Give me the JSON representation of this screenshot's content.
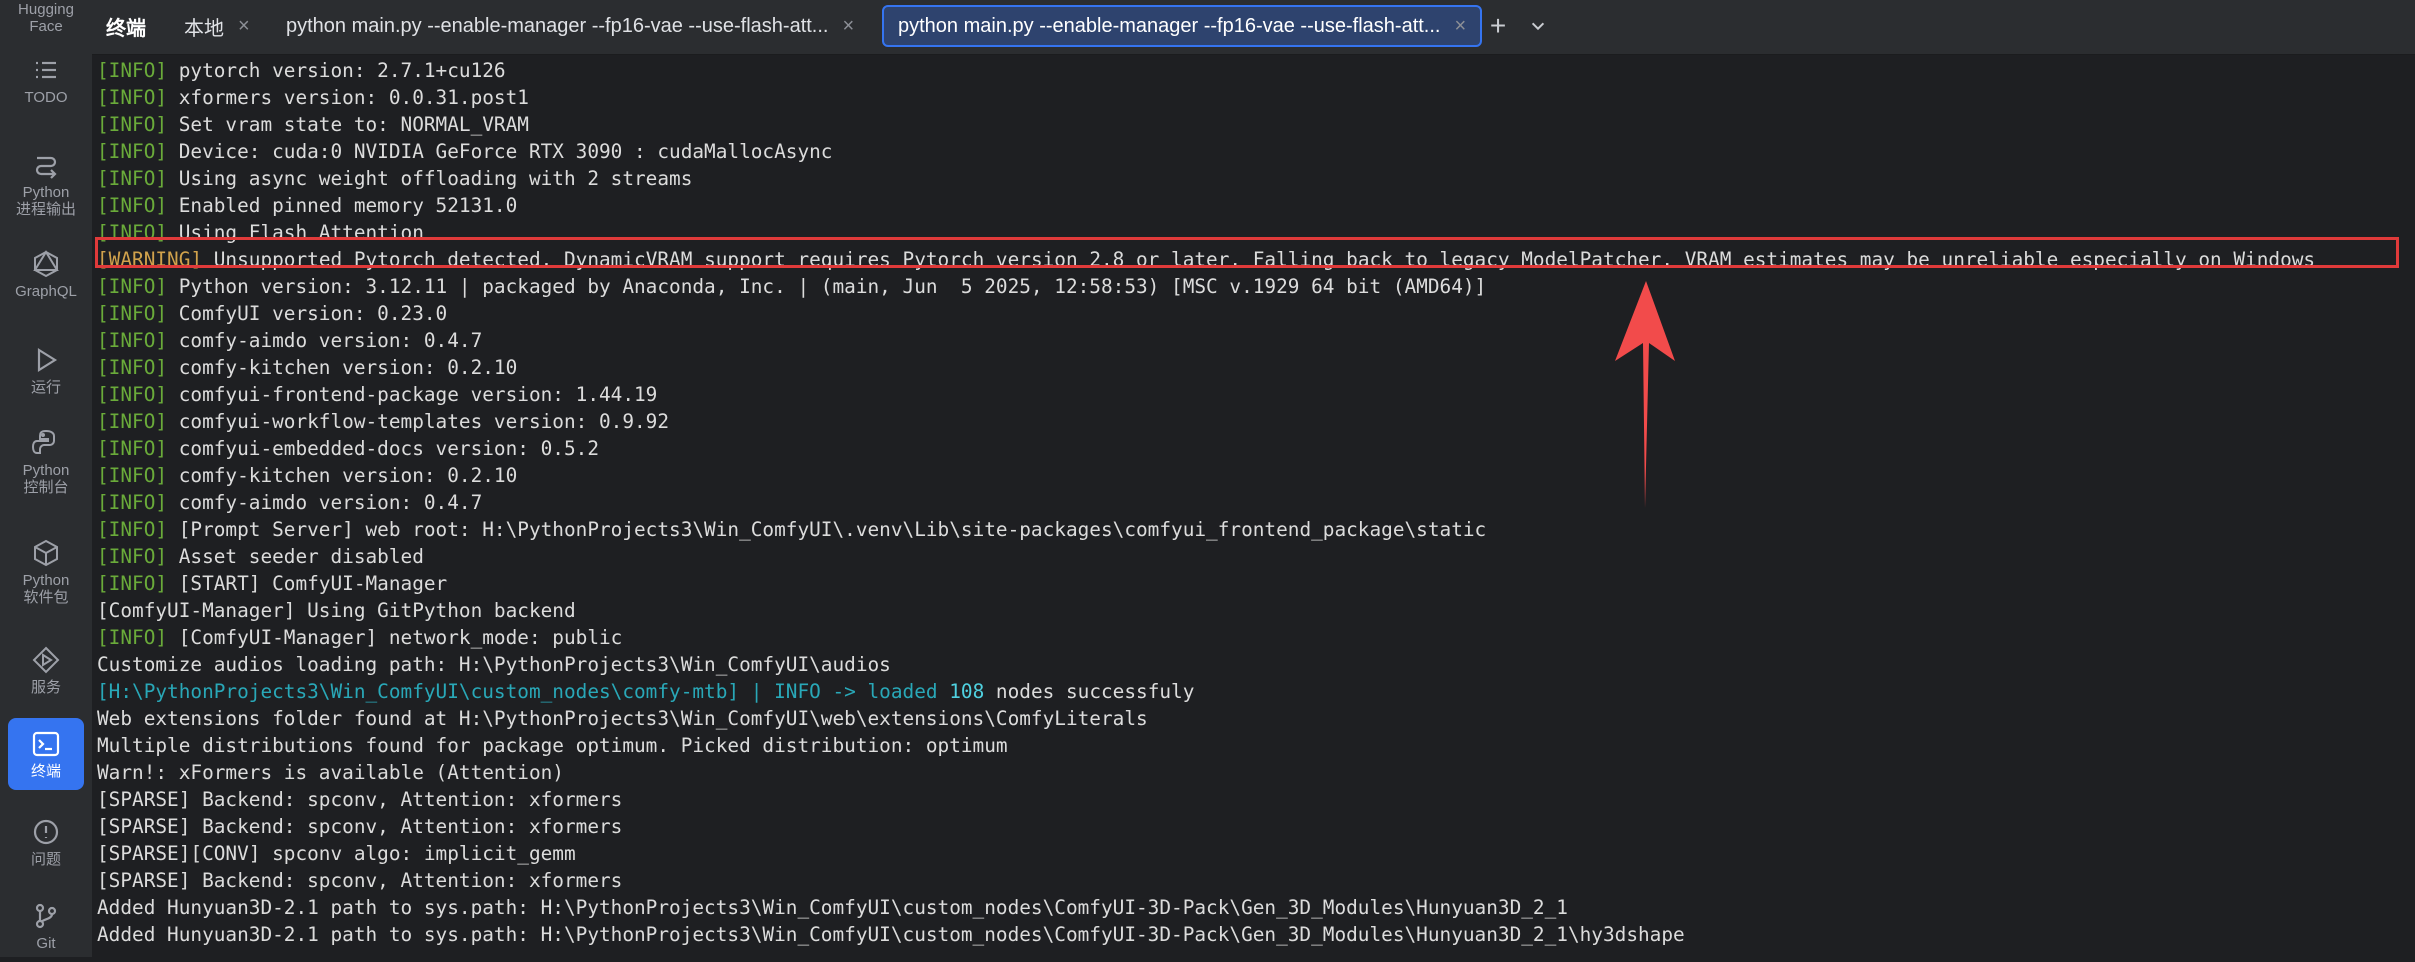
{
  "sidebar": {
    "items": [
      {
        "label": "Hugging\nFace",
        "icon": "hugging-face-icon"
      },
      {
        "label": "TODO",
        "icon": "todo-list-icon"
      },
      {
        "label": "Python\n进程输出",
        "icon": "process-output-icon"
      },
      {
        "label": "GraphQL",
        "icon": "graphql-icon"
      },
      {
        "label": "运行",
        "icon": "run-icon"
      },
      {
        "label": "Python\n控制台",
        "icon": "python-console-icon"
      },
      {
        "label": "Python\n软件包",
        "icon": "python-packages-icon"
      },
      {
        "label": "服务",
        "icon": "services-icon"
      },
      {
        "label": "终端",
        "icon": "terminal-icon",
        "active": true
      },
      {
        "label": "问题",
        "icon": "problems-icon"
      },
      {
        "label": "Git",
        "icon": "git-icon"
      }
    ]
  },
  "tabs": {
    "title": "终端",
    "items": [
      {
        "label": "本地"
      },
      {
        "label": "python main.py --enable-manager --fp16-vae --use-flash-att..."
      },
      {
        "label": "python main.py --enable-manager --fp16-vae --use-flash-att...",
        "active": true
      }
    ]
  },
  "terminal": {
    "lines": [
      {
        "level": "[INFO]",
        "text": " pytorch version: 2.7.1+cu126"
      },
      {
        "level": "[INFO]",
        "text": " xformers version: 0.0.31.post1"
      },
      {
        "level": "[INFO]",
        "text": " Set vram state to: NORMAL_VRAM"
      },
      {
        "level": "[INFO]",
        "text": " Device: cuda:0 NVIDIA GeForce RTX 3090 : cudaMallocAsync"
      },
      {
        "level": "[INFO]",
        "text": " Using async weight offloading with 2 streams"
      },
      {
        "level": "[INFO]",
        "text": " Enabled pinned memory 52131.0"
      },
      {
        "level": "[INFO]",
        "text": " Using Flash Attention"
      },
      {
        "level": "[WARNING]",
        "warn": true,
        "text": " Unsupported Pytorch detected. DynamicVRAM support requires Pytorch version 2.8 or later. Falling back to legacy ModelPatcher. VRAM estimates may be unreliable especially on Windows"
      },
      {
        "level": "[INFO]",
        "text": " Python version: 3.12.11 | packaged by Anaconda, Inc. | (main, Jun  5 2025, 12:58:53) [MSC v.1929 64 bit (AMD64)]"
      },
      {
        "level": "[INFO]",
        "text": " ComfyUI version: 0.23.0"
      },
      {
        "level": "[INFO]",
        "text": " comfy-aimdo version: 0.4.7"
      },
      {
        "level": "[INFO]",
        "text": " comfy-kitchen version: 0.2.10"
      },
      {
        "level": "[INFO]",
        "text": " comfyui-frontend-package version: 1.44.19"
      },
      {
        "level": "[INFO]",
        "text": " comfyui-workflow-templates version: 0.9.92"
      },
      {
        "level": "[INFO]",
        "text": " comfyui-embedded-docs version: 0.5.2"
      },
      {
        "level": "[INFO]",
        "text": " comfy-kitchen version: 0.2.10"
      },
      {
        "level": "[INFO]",
        "text": " comfy-aimdo version: 0.4.7"
      },
      {
        "level": "[INFO]",
        "text": " [Prompt Server] web root: H:\\PythonProjects3\\Win_ComfyUI\\.venv\\Lib\\site-packages\\comfyui_frontend_package\\static"
      },
      {
        "level": "[INFO]",
        "text": " Asset seeder disabled"
      },
      {
        "level": "[INFO]",
        "text": " [START] ComfyUI-Manager"
      },
      {
        "level": "",
        "text": "[ComfyUI-Manager] Using GitPython backend"
      },
      {
        "level": "[INFO]",
        "text": " [ComfyUI-Manager] network_mode: public"
      },
      {
        "level": "",
        "text": "Customize audios loading path: H:\\PythonProjects3\\Win_ComfyUI\\audios"
      },
      {
        "level": "",
        "teal": "[H:\\PythonProjects3\\Win_ComfyUI\\custom_nodes\\comfy-mtb] | INFO -> loaded ",
        "num": "108",
        "text": " nodes successfuly"
      },
      {
        "level": "",
        "text": "Web extensions folder found at H:\\PythonProjects3\\Win_ComfyUI\\web\\extensions\\ComfyLiterals"
      },
      {
        "level": "",
        "text": "Multiple distributions found for package optimum. Picked distribution: optimum"
      },
      {
        "level": "",
        "text": "Warn!: xFormers is available (Attention)"
      },
      {
        "level": "",
        "text": "[SPARSE] Backend: spconv, Attention: xformers"
      },
      {
        "level": "",
        "text": "[SPARSE] Backend: spconv, Attention: xformers"
      },
      {
        "level": "",
        "text": "[SPARSE][CONV] spconv algo: implicit_gemm"
      },
      {
        "level": "",
        "text": "[SPARSE] Backend: spconv, Attention: xformers"
      },
      {
        "level": "",
        "text": "Added Hunyuan3D-2.1 path to sys.path: H:\\PythonProjects3\\Win_ComfyUI\\custom_nodes\\ComfyUI-3D-Pack\\Gen_3D_Modules\\Hunyuan3D_2_1"
      },
      {
        "level": "",
        "text": "Added Hunyuan3D-2.1 path to sys.path: H:\\PythonProjects3\\Win_ComfyUI\\custom_nodes\\ComfyUI-3D-Pack\\Gen_3D_Modules\\Hunyuan3D_2_1\\hy3dshape"
      }
    ]
  },
  "annotation": {
    "highlight_color": "#e03a3a",
    "arrow_color": "#f24b4b"
  }
}
